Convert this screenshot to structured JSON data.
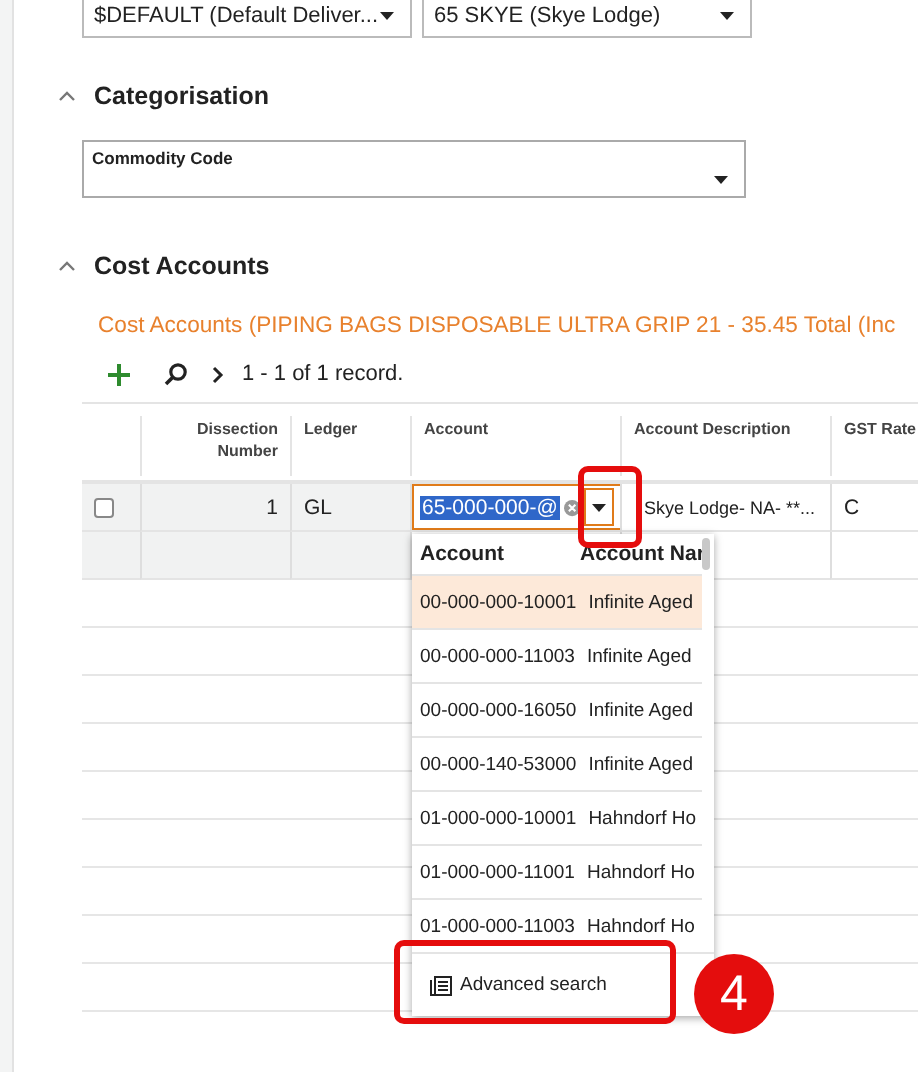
{
  "delivery_fields": [
    {
      "value": "$DEFAULT (Default Deliver..."
    },
    {
      "value": "65 SKYE (Skye Lodge)"
    }
  ],
  "sections": [
    {
      "title": "Categorisation",
      "expanded": true
    },
    {
      "title": "Cost Accounts",
      "expanded": true
    }
  ],
  "commodity_field": {
    "label": "Commodity Code"
  },
  "cost_accounts": {
    "title": "Cost Accounts (PIPING BAGS DISPOSABLE ULTRA GRIP 21 - 35.45 Total (Inc",
    "record_count": "1 - 1 of 1 record.",
    "columns": [
      "",
      "Dissection Number",
      "Ledger",
      "Account",
      "Account Description",
      "GST Rate"
    ],
    "rows": [
      {
        "checked": false,
        "dissection": "1",
        "ledger": "GL",
        "account": "65-000-000-@",
        "description": "Skye Lodge- NA- **...",
        "gst_rate": "C"
      }
    ]
  },
  "dropdown": {
    "columns": [
      "Account",
      "Account Nar"
    ],
    "items": [
      {
        "account": "00-000-000-10001",
        "name": "Infinite Aged",
        "selected": true
      },
      {
        "account": "00-000-000-11003",
        "name": "Infinite Aged",
        "selected": false
      },
      {
        "account": "00-000-000-16050",
        "name": "Infinite Aged",
        "selected": false
      },
      {
        "account": "00-000-140-53000",
        "name": "Infinite Aged",
        "selected": false
      },
      {
        "account": "01-000-000-10001",
        "name": "Hahndorf Ho",
        "selected": false
      },
      {
        "account": "01-000-000-11001",
        "name": "Hahndorf Ho",
        "selected": false
      },
      {
        "account": "01-000-000-11003",
        "name": "Hahndorf Ho",
        "selected": false
      }
    ],
    "advanced_search": "Advanced search"
  },
  "annotation": {
    "step": "4"
  }
}
